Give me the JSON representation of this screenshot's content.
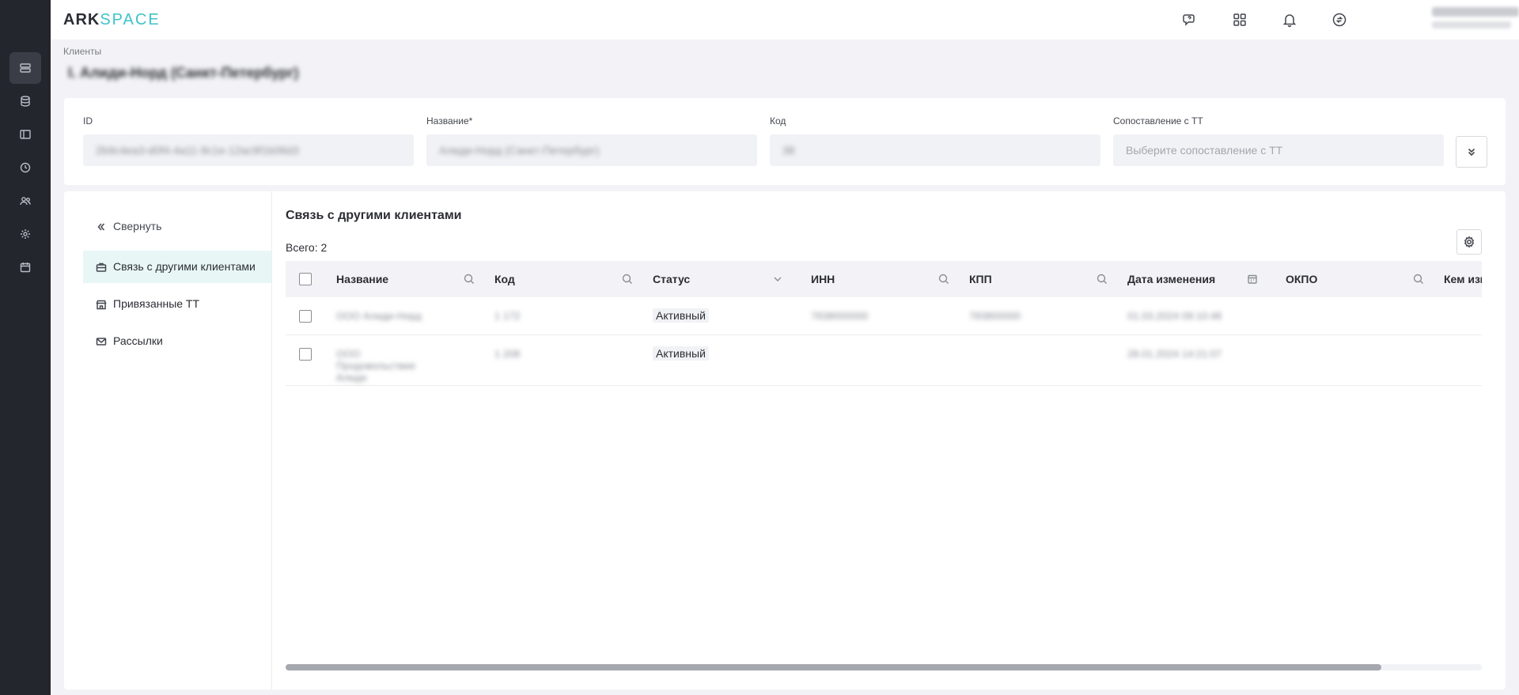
{
  "app": {
    "logo_ark": "ARK",
    "logo_space": "SPACE"
  },
  "breadcrumb": "Клиенты",
  "page_title": "I. Алиди-Норд (Санкт-Петербург)",
  "form": {
    "id_label": "ID",
    "id_value": "2b9c4ea3-d0f4-4a11-9c1e-12ac9f1b06d3",
    "name_label": "Название*",
    "name_value": "Алиди-Норд (Санкт-Петербург)",
    "code_label": "Код",
    "code_value": "38",
    "match_label": "Сопоставление с ТТ",
    "match_placeholder": "Выберите сопоставление с ТТ"
  },
  "side_nav": {
    "collapse": "Свернуть",
    "items": [
      {
        "label": "Связь с другими клиентами",
        "icon": "briefcase-icon",
        "active": true
      },
      {
        "label": "Привязанные ТТ",
        "icon": "store-icon",
        "active": false
      },
      {
        "label": "Рассылки",
        "icon": "mail-icon",
        "active": false
      }
    ]
  },
  "section": {
    "title": "Связь с другими клиентами",
    "total": "Всего: 2"
  },
  "table": {
    "columns": [
      "Название",
      "Код",
      "Статус",
      "ИНН",
      "КПП",
      "Дата изменения",
      "ОКПО",
      "Кем изм"
    ],
    "rows": [
      {
        "name": "ООО Алиди-Норд",
        "code": "1 172",
        "status": "Активный",
        "inn": "7838000000",
        "kpp": "783800000",
        "date": "01.03.2024 09:10:48"
      },
      {
        "name": "ООО Продовольствие Алиди",
        "code": "1 208",
        "status": "Активный",
        "inn": "",
        "kpp": "",
        "date": "28.01.2024 14:21:07"
      }
    ]
  },
  "colors": {
    "accent": "#3ec2c9",
    "rail": "#24262d",
    "active_nav": "#e8f6f6"
  }
}
